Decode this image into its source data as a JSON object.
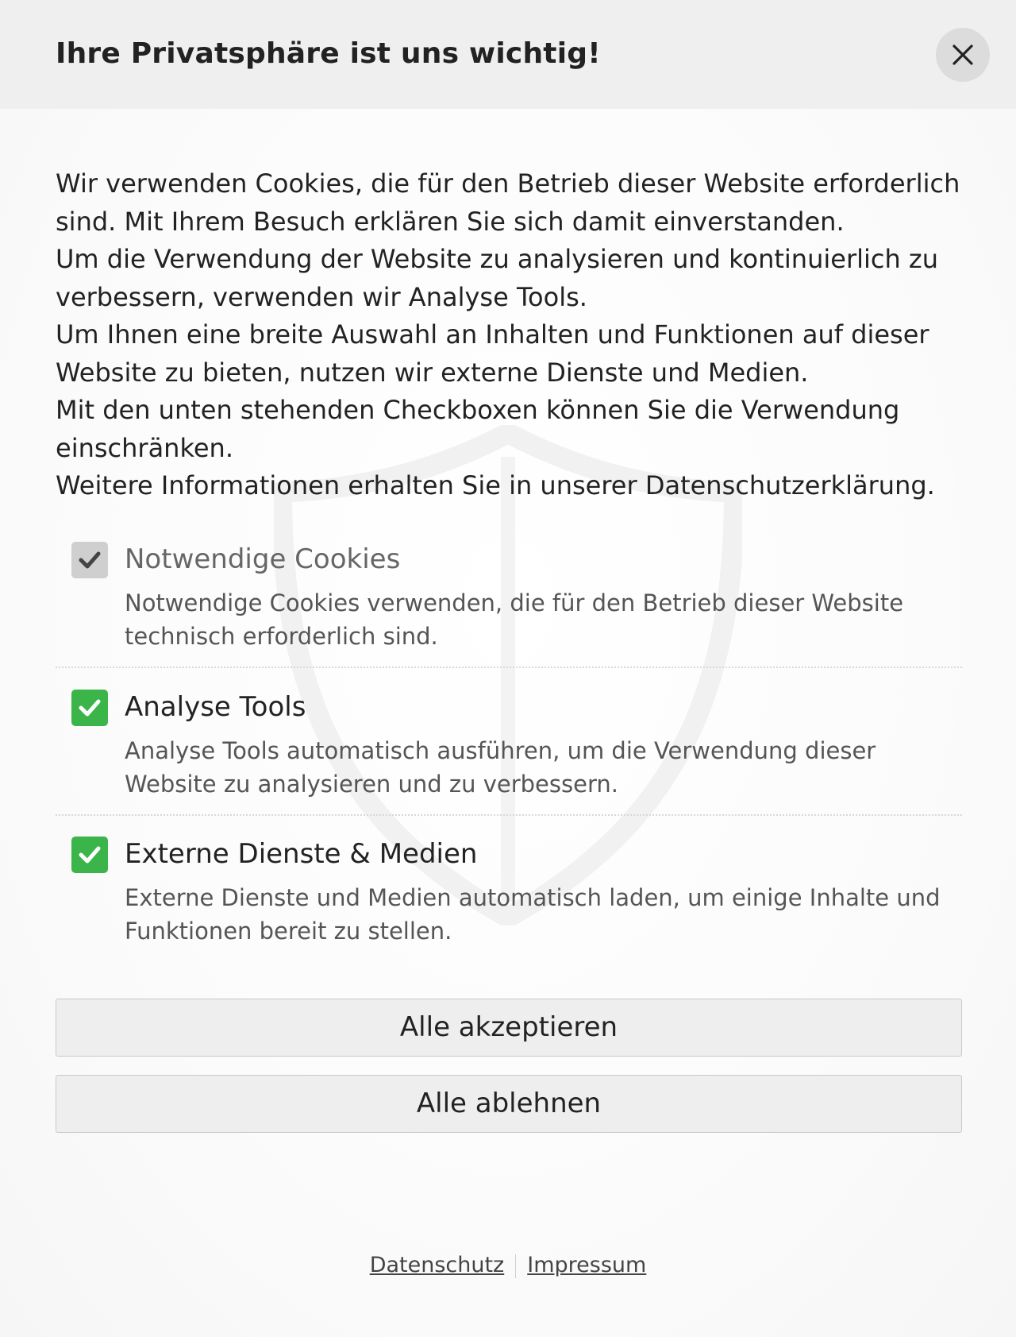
{
  "header": {
    "title": "Ihre Privatsphäre ist uns wichtig!",
    "close_icon": "close-icon"
  },
  "intro": {
    "lines": [
      "Wir verwenden Cookies, die für den Betrieb dieser Website erforderlich",
      "sind. Mit Ihrem Besuch erklären Sie sich damit einverstanden.",
      "Um die Verwendung der Website zu analysieren und kontinuierlich zu",
      "verbessern, verwenden wir Analyse Tools.",
      "Um Ihnen eine breite Auswahl an Inhalten und Funktionen auf dieser",
      "Website zu bieten, nutzen wir externe Dienste und Medien.",
      "Mit den unten stehenden Checkboxen können Sie die Verwendung",
      "einschränken.",
      "Weitere Informationen erhalten Sie in unserer Datenschutzerklärung."
    ]
  },
  "options": [
    {
      "title": "Notwendige Cookies",
      "description": "Notwendige Cookies verwenden, die für den Betrieb dieser Website technisch erforderlich sind.",
      "checked": true,
      "disabled": true
    },
    {
      "title": "Analyse Tools",
      "description": "Analyse Tools automatisch ausführen, um die Verwendung dieser Website zu analysieren und zu verbessern.",
      "checked": true,
      "disabled": false
    },
    {
      "title": "Externe Dienste & Medien",
      "description": "Externe Dienste und Medien automatisch laden, um einige Inhalte und Funktionen bereit zu stellen.",
      "checked": true,
      "disabled": false
    }
  ],
  "buttons": {
    "accept_all": "Alle akzeptieren",
    "decline_all": "Alle ablehnen"
  },
  "footer": {
    "privacy_link": "Datenschutz",
    "imprint_link": "Impressum"
  },
  "colors": {
    "checkbox_checked": "#3bb54a",
    "checkbox_disabled": "#cfcfcf",
    "header_bg": "#efefef"
  },
  "icons": {
    "watermark": "shield-icon",
    "check": "check-icon"
  }
}
